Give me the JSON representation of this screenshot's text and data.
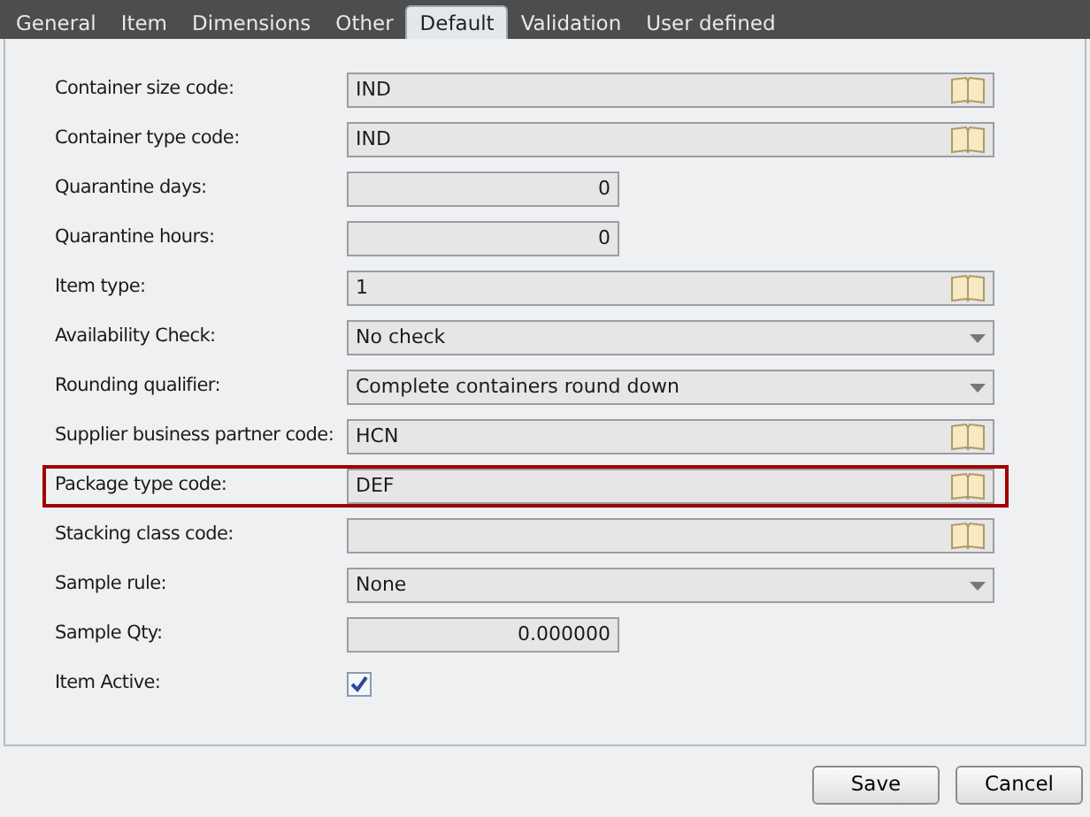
{
  "tabs": [
    {
      "label": "General",
      "selected": false
    },
    {
      "label": "Item",
      "selected": false
    },
    {
      "label": "Dimensions",
      "selected": false
    },
    {
      "label": "Other",
      "selected": false
    },
    {
      "label": "Default",
      "selected": true
    },
    {
      "label": "Validation",
      "selected": false
    },
    {
      "label": "User defined",
      "selected": false
    }
  ],
  "fields": [
    {
      "kind": "lookup",
      "label": "Container size code:",
      "value": "IND",
      "highlighted": false
    },
    {
      "kind": "lookup",
      "label": "Container type code:",
      "value": "IND",
      "highlighted": false
    },
    {
      "kind": "number",
      "label": "Quarantine days:",
      "value": "0",
      "highlighted": false
    },
    {
      "kind": "number",
      "label": "Quarantine hours:",
      "value": "0",
      "highlighted": false
    },
    {
      "kind": "lookup",
      "label": "Item type:",
      "value": "1",
      "highlighted": false
    },
    {
      "kind": "select",
      "label": "Availability Check:",
      "value": "No check",
      "highlighted": false
    },
    {
      "kind": "select",
      "label": "Rounding qualifier:",
      "value": "Complete containers round down",
      "highlighted": false
    },
    {
      "kind": "lookup",
      "label": "Supplier business partner code:",
      "value": "HCN",
      "highlighted": false
    },
    {
      "kind": "lookup",
      "label": "Package type code:",
      "value": "DEF",
      "highlighted": true
    },
    {
      "kind": "lookup",
      "label": "Stacking class code:",
      "highlighted": false
    },
    {
      "kind": "select",
      "label": "Sample rule:",
      "value": "None",
      "highlighted": false
    },
    {
      "kind": "number",
      "label": "Sample Qty:",
      "value": "0.000000",
      "highlighted": false
    },
    {
      "kind": "checkbox",
      "label": "Item Active:",
      "checked": true,
      "highlighted": false
    }
  ],
  "buttons": [
    "Save",
    "Cancel"
  ]
}
